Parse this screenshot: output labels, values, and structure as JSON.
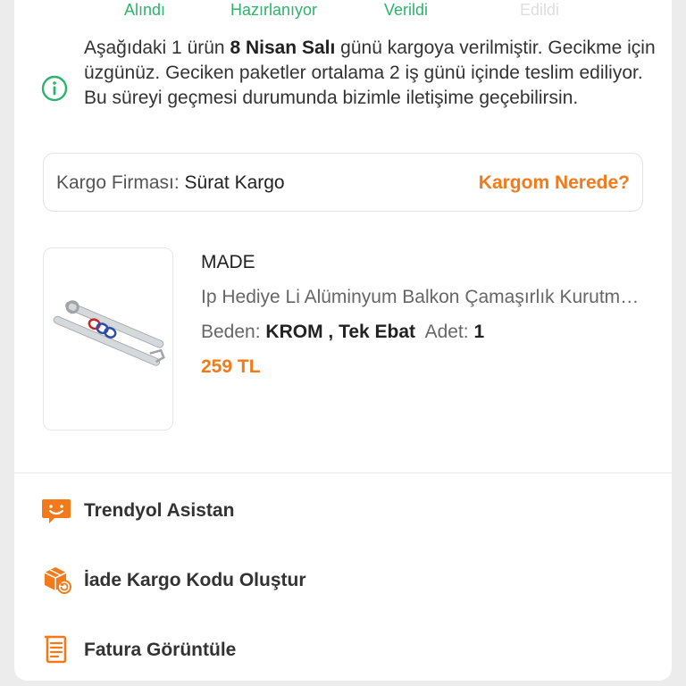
{
  "status_steps": [
    {
      "label": "Alındı",
      "state": "done"
    },
    {
      "label": "Hazırlanıyor",
      "state": "done"
    },
    {
      "label": "Verildi",
      "state": "done"
    },
    {
      "label": "Edildi",
      "state": "pending"
    }
  ],
  "notice": {
    "text_before": "Aşağıdaki 1 ürün ",
    "date": "8 Nisan Salı",
    "text_after": " günü kargoya verilmiştir. Gecikme için üzgünüz. Geciken paketler ortalama 2 iş günü içinde teslim ediliyor. Bu süreyi geçmesi durumunda bizimle iletişime geçebilirsin.",
    "icon": "info-icon"
  },
  "cargo": {
    "label": "Kargo Firması:",
    "company": "Sürat Kargo",
    "link": "Kargom Nerede?"
  },
  "product": {
    "brand": "MADE",
    "name": "Ip Hediye Li Alüminyum Balkon Çamaşırlık Kurutmalık",
    "size_label": "Beden:",
    "size_value": "KROM , Tek Ebat",
    "qty_label": "Adet:",
    "qty_value": "1",
    "price": "259 TL"
  },
  "actions": [
    {
      "label": "Trendyol Asistan",
      "icon": "chat-bubble-icon"
    },
    {
      "label": "İade Kargo Kodu Oluştur",
      "icon": "return-box-icon"
    },
    {
      "label": "Fatura Görüntüle",
      "icon": "invoice-icon"
    }
  ],
  "colors": {
    "accent": "#f27a1a",
    "success": "#2db36b",
    "pending": "#dedede"
  }
}
